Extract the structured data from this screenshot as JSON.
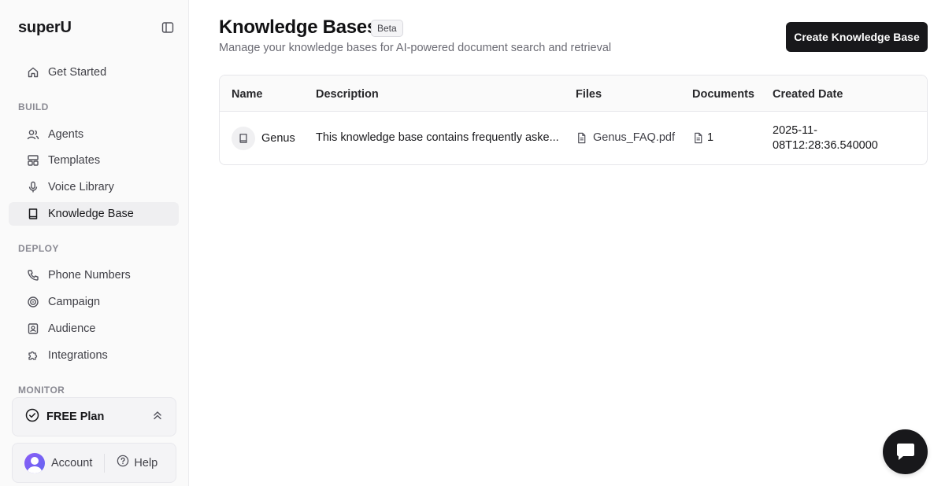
{
  "brand": {
    "name": "superU"
  },
  "sidebar": {
    "get_started": "Get Started",
    "sections": {
      "build": "BUILD",
      "deploy": "DEPLOY",
      "monitor": "MONITOR"
    },
    "build_items": [
      {
        "label": "Agents",
        "icon": "users-icon"
      },
      {
        "label": "Templates",
        "icon": "layout-icon"
      },
      {
        "label": "Voice Library",
        "icon": "microphone-icon"
      },
      {
        "label": "Knowledge Base",
        "icon": "book-icon",
        "active": true
      }
    ],
    "deploy_items": [
      {
        "label": "Phone Numbers",
        "icon": "phone-icon"
      },
      {
        "label": "Campaign",
        "icon": "target-icon"
      },
      {
        "label": "Audience",
        "icon": "contact-icon"
      },
      {
        "label": "Integrations",
        "icon": "puzzle-icon"
      }
    ],
    "plan": {
      "label": "FREE Plan"
    },
    "account": {
      "label": "Account"
    },
    "help": {
      "label": "Help"
    }
  },
  "header": {
    "title": "Knowledge Bases",
    "badge": "Beta",
    "subtitle": "Manage your knowledge bases for AI-powered document search and retrieval",
    "create_button": "Create Knowledge Base"
  },
  "table": {
    "columns": [
      "Name",
      "Description",
      "Files",
      "Documents",
      "Created Date"
    ],
    "rows": [
      {
        "name": "Genus",
        "description": "This knowledge base contains frequently aske...",
        "file": "Genus_FAQ.pdf",
        "documents": "1",
        "created_line1": "2025-11-",
        "created_line2": "08T12:28:36.540000"
      }
    ]
  },
  "colors": {
    "accent": "#18181b",
    "sidebar_bg": "#fafafa",
    "active_item_bg": "#efeff1"
  }
}
